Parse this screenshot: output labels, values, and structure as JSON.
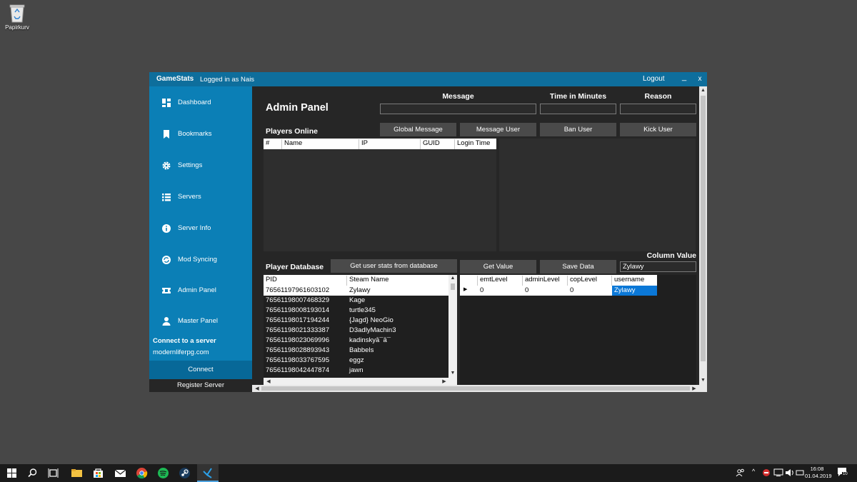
{
  "desktop": {
    "recycle_bin_label": "Papirkurv"
  },
  "window": {
    "app_name": "GameStats",
    "logged_in": "Logged in as Nais",
    "logout": "Logout",
    "minimize": "_",
    "close": "x"
  },
  "sidebar": {
    "items": [
      {
        "label": "Dashboard",
        "icon": "dashboard-icon"
      },
      {
        "label": "Bookmarks",
        "icon": "bookmark-icon"
      },
      {
        "label": "Settings",
        "icon": "gear-icon"
      },
      {
        "label": "Servers",
        "icon": "list-icon"
      },
      {
        "label": "Server Info",
        "icon": "info-icon"
      },
      {
        "label": "Mod Syncing",
        "icon": "sync-icon"
      },
      {
        "label": "Admin Panel",
        "icon": "ticket-icon"
      },
      {
        "label": "Master Panel",
        "icon": "user-icon"
      }
    ],
    "connect_title": "Connect to a server",
    "connect_host": "modernliferpg.com",
    "connect_button": "Connect",
    "register_button": "Register Server"
  },
  "admin": {
    "title": "Admin Panel",
    "message_label": "Message",
    "time_label": "Time in Minutes",
    "reason_label": "Reason",
    "message_value": "",
    "time_value": "",
    "reason_value": "",
    "buttons": {
      "global_message": "Global Message",
      "message_user": "Message User",
      "ban_user": "Ban User",
      "kick_user": "Kick User"
    },
    "players_online_title": "Players Online",
    "players_columns": [
      "#",
      "Name",
      "IP",
      "GUID",
      "Login Time"
    ],
    "player_db_title": "Player Database",
    "get_stats_button": "Get user stats from database",
    "get_value_button": "Get Value",
    "save_data_button": "Save Data",
    "column_value_label": "Column Value",
    "column_value": "Zylawy",
    "db_columns": [
      "PID",
      "Steam Name"
    ],
    "db_rows": [
      {
        "pid": "76561197961603102",
        "name": "Zylawy"
      },
      {
        "pid": "76561198007468329",
        "name": "Kage"
      },
      {
        "pid": "76561198008193014",
        "name": "turtle345"
      },
      {
        "pid": "76561198017194244",
        "name": "{Jagd} NeoGio"
      },
      {
        "pid": "76561198021333387",
        "name": "D3adlyMachin3"
      },
      {
        "pid": "76561198023069996",
        "name": "kadinskyā¯ā¯"
      },
      {
        "pid": "76561198028893943",
        "name": "Babbels"
      },
      {
        "pid": "76561198033767595",
        "name": "eggz"
      },
      {
        "pid": "76561198042447874",
        "name": "jawn"
      }
    ],
    "detail_columns": [
      "emtLevel",
      "adminLevel",
      "copLevel",
      "username"
    ],
    "detail_row": [
      "0",
      "0",
      "0",
      "Zylawy"
    ]
  },
  "taskbar": {
    "time": "16:08",
    "date": "01.04.2019",
    "notifications": "10"
  },
  "colors": {
    "accent": "#0b7fb6",
    "titlebar": "#0e6e9c",
    "panel": "#262626",
    "desktop": "#474747"
  }
}
